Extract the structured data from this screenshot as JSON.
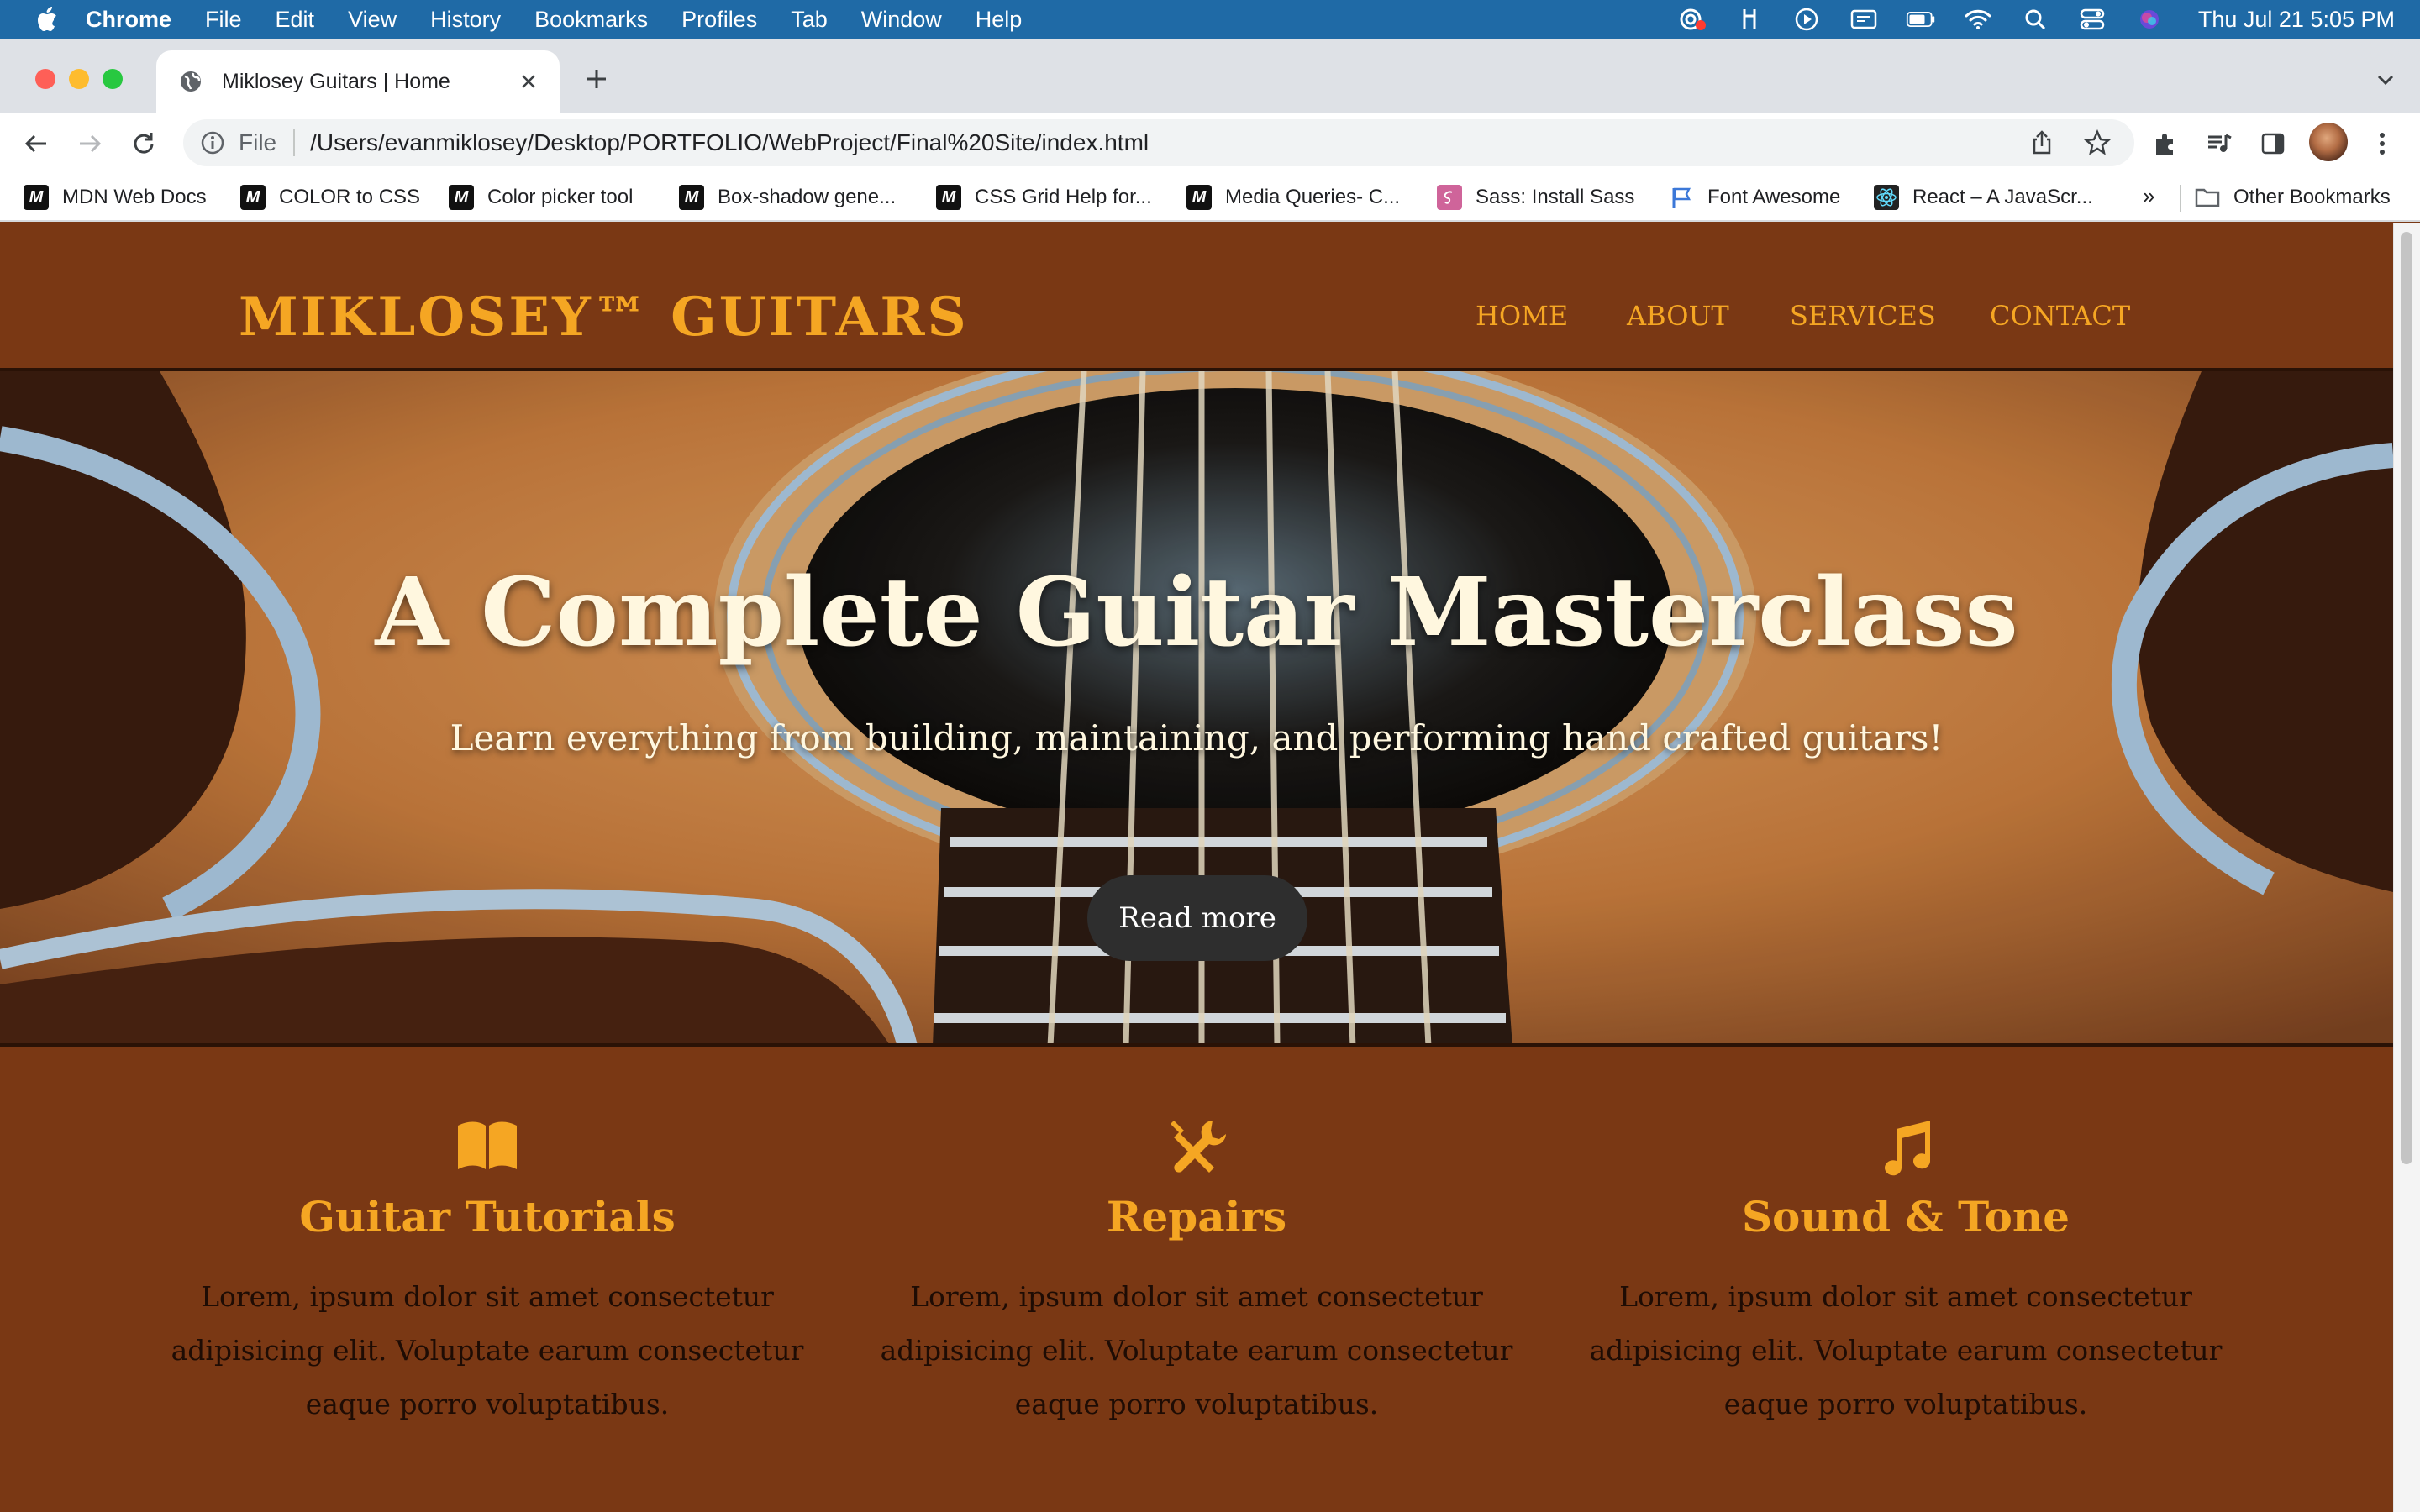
{
  "menubar": {
    "app_name": "Chrome",
    "items": [
      "File",
      "Edit",
      "View",
      "History",
      "Bookmarks",
      "Profiles",
      "Tab",
      "Window",
      "Help"
    ],
    "clock": "Thu Jul 21  5:05 PM",
    "status_icons": [
      "screen-record-icon",
      "fork-icon",
      "play-icon",
      "display-icon",
      "battery-icon",
      "wifi-icon",
      "spotlight-icon",
      "control-center-icon",
      "siri-icon"
    ]
  },
  "tab": {
    "title": "Miklosey Guitars | Home"
  },
  "toolbar": {
    "scheme": "File",
    "url": "/Users/evanmiklosey/Desktop/PORTFOLIO/WebProject/Final%20Site/index.html"
  },
  "bookmarks": {
    "items": [
      "MDN Web Docs",
      "COLOR to CSS",
      "Color picker tool",
      "Box-shadow gene...",
      "CSS Grid Help for...",
      "Media Queries- C...",
      "Sass: Install Sass",
      "Font Awesome",
      "React – A JavaScr..."
    ],
    "more": "»",
    "other": "Other Bookmarks"
  },
  "site": {
    "logo": "MIKLOSEY™ GUITARS",
    "nav": [
      "HOME",
      "ABOUT",
      "SERVICES",
      "CONTACT"
    ],
    "hero": {
      "title": "A Complete Guitar Masterclass",
      "subtitle": "Learn everything from building, maintaining, and performing hand crafted guitars!",
      "button": "Read more"
    },
    "features": [
      {
        "icon": "book-open-icon",
        "title": "Guitar Tutorials",
        "text": "Lorem, ipsum dolor sit amet consectetur adipisicing elit. Voluptate earum consectetur eaque porro voluptatibus."
      },
      {
        "icon": "tools-icon",
        "title": "Repairs",
        "text": "Lorem, ipsum dolor sit amet consectetur adipisicing elit. Voluptate earum consectetur eaque porro voluptatibus."
      },
      {
        "icon": "music-note-icon",
        "title": "Sound & Tone",
        "text": "Lorem, ipsum dolor sit amet consectetur adipisicing elit. Voluptate earum consectetur eaque porro voluptatibus."
      }
    ]
  },
  "colors": {
    "page_brown": "#7a3814",
    "accent_gold": "#f5a623",
    "hero_text": "#fff7df",
    "button_dark": "#2e2e2e",
    "menubar_blue": "#1f6aa6"
  }
}
